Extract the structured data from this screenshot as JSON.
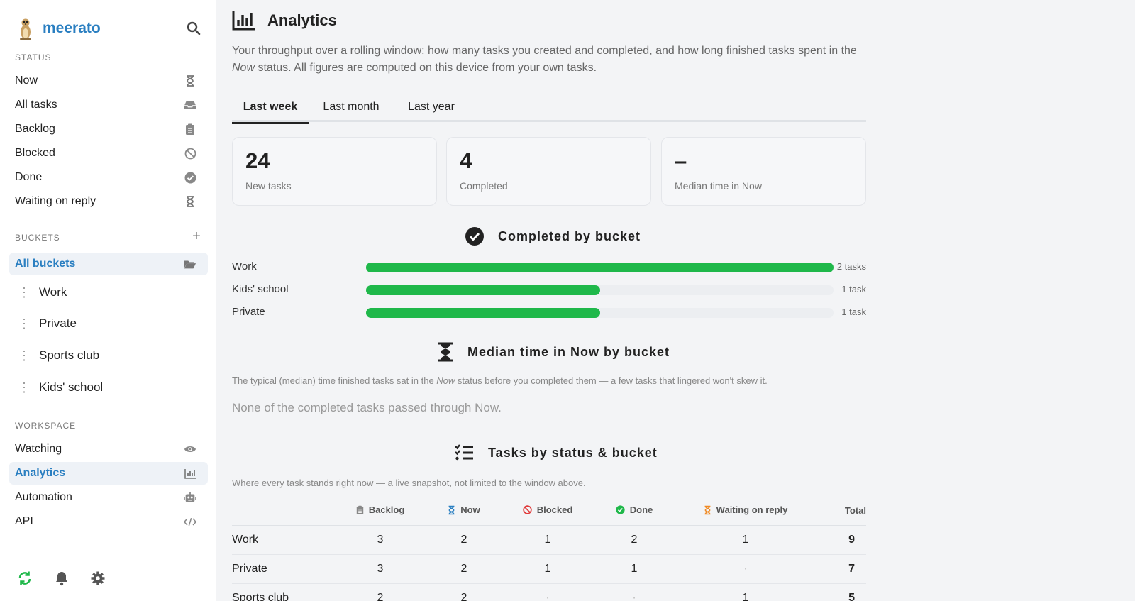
{
  "app": {
    "name": "meerato"
  },
  "sidebar": {
    "status_label": "STATUS",
    "status_items": [
      {
        "label": "Now",
        "icon": "hourglass-icon"
      },
      {
        "label": "All tasks",
        "icon": "inbox-icon"
      },
      {
        "label": "Backlog",
        "icon": "clipboard-icon"
      },
      {
        "label": "Blocked",
        "icon": "ban-icon"
      },
      {
        "label": "Done",
        "icon": "check-circle-icon"
      },
      {
        "label": "Waiting on reply",
        "icon": "hourglass-icon"
      }
    ],
    "buckets_label": "BUCKETS",
    "all_buckets": "All buckets",
    "buckets": [
      "Work",
      "Private",
      "Sports club",
      "Kids' school"
    ],
    "workspace_label": "WORKSPACE",
    "workspace_items": [
      {
        "label": "Watching",
        "icon": "eye-icon"
      },
      {
        "label": "Analytics",
        "icon": "chart-icon"
      },
      {
        "label": "Automation",
        "icon": "robot-icon"
      },
      {
        "label": "API",
        "icon": "code-icon"
      }
    ]
  },
  "page": {
    "title": "Analytics",
    "intro_1": "Your throughput over a rolling window: how many tasks you created and completed, and how long finished tasks spent in the ",
    "intro_em": "Now",
    "intro_2": " status. All figures are computed on this device from your own tasks."
  },
  "tabs": [
    "Last week",
    "Last month",
    "Last year"
  ],
  "active_tab": "Last week",
  "cards": [
    {
      "value": "24",
      "label": "New tasks"
    },
    {
      "value": "4",
      "label": "Completed"
    },
    {
      "value": "–",
      "label": "Median time in Now"
    }
  ],
  "completed_section": {
    "title": "Completed by bucket",
    "rows": [
      {
        "name": "Work",
        "fraction": 1.0,
        "count": "2 tasks"
      },
      {
        "name": "Kids' school",
        "fraction": 0.5,
        "count": "1 task"
      },
      {
        "name": "Private",
        "fraction": 0.5,
        "count": "1 task"
      }
    ]
  },
  "median_section": {
    "title": "Median time in Now by bucket",
    "note_1": "The typical (median) time finished tasks sat in the ",
    "note_em": "Now",
    "note_2": " status before you completed them — a few tasks that lingered won't skew it.",
    "empty": "None of the completed tasks passed through Now."
  },
  "status_section": {
    "title": "Tasks by status & bucket",
    "note": "Where every task stands right now — a live snapshot, not limited to the window above.",
    "columns": [
      "Backlog",
      "Now",
      "Blocked",
      "Done",
      "Waiting on reply",
      "Total"
    ],
    "rows": [
      {
        "name": "Work",
        "cells": [
          "3",
          "2",
          "1",
          "2",
          "1",
          "9"
        ]
      },
      {
        "name": "Private",
        "cells": [
          "3",
          "2",
          "1",
          "1",
          "·",
          "7"
        ]
      },
      {
        "name": "Sports club",
        "cells": [
          "2",
          "2",
          "·",
          "·",
          "1",
          "5"
        ]
      }
    ]
  },
  "colors": {
    "accent": "#2a7fc1",
    "bar": "#1fb84a",
    "now": "#2a7fc1",
    "blocked": "#e03b3b",
    "done": "#1fb84a",
    "waiting": "#f08a24"
  }
}
